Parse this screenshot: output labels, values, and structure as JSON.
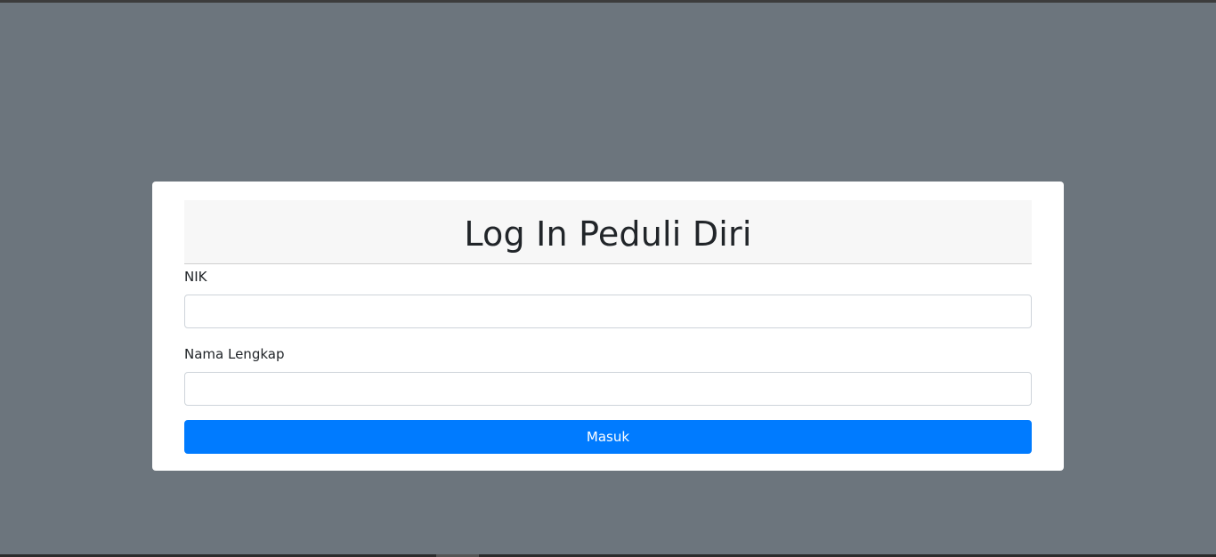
{
  "login": {
    "title": "Log In Peduli Diri",
    "nik_label": "NIK",
    "nik_value": "",
    "nama_label": "Nama Lengkap",
    "nama_value": "",
    "submit_label": "Masuk"
  },
  "colors": {
    "background": "#6c757d",
    "primary": "#007bff",
    "card": "#ffffff",
    "header_bg": "#f7f7f7"
  }
}
